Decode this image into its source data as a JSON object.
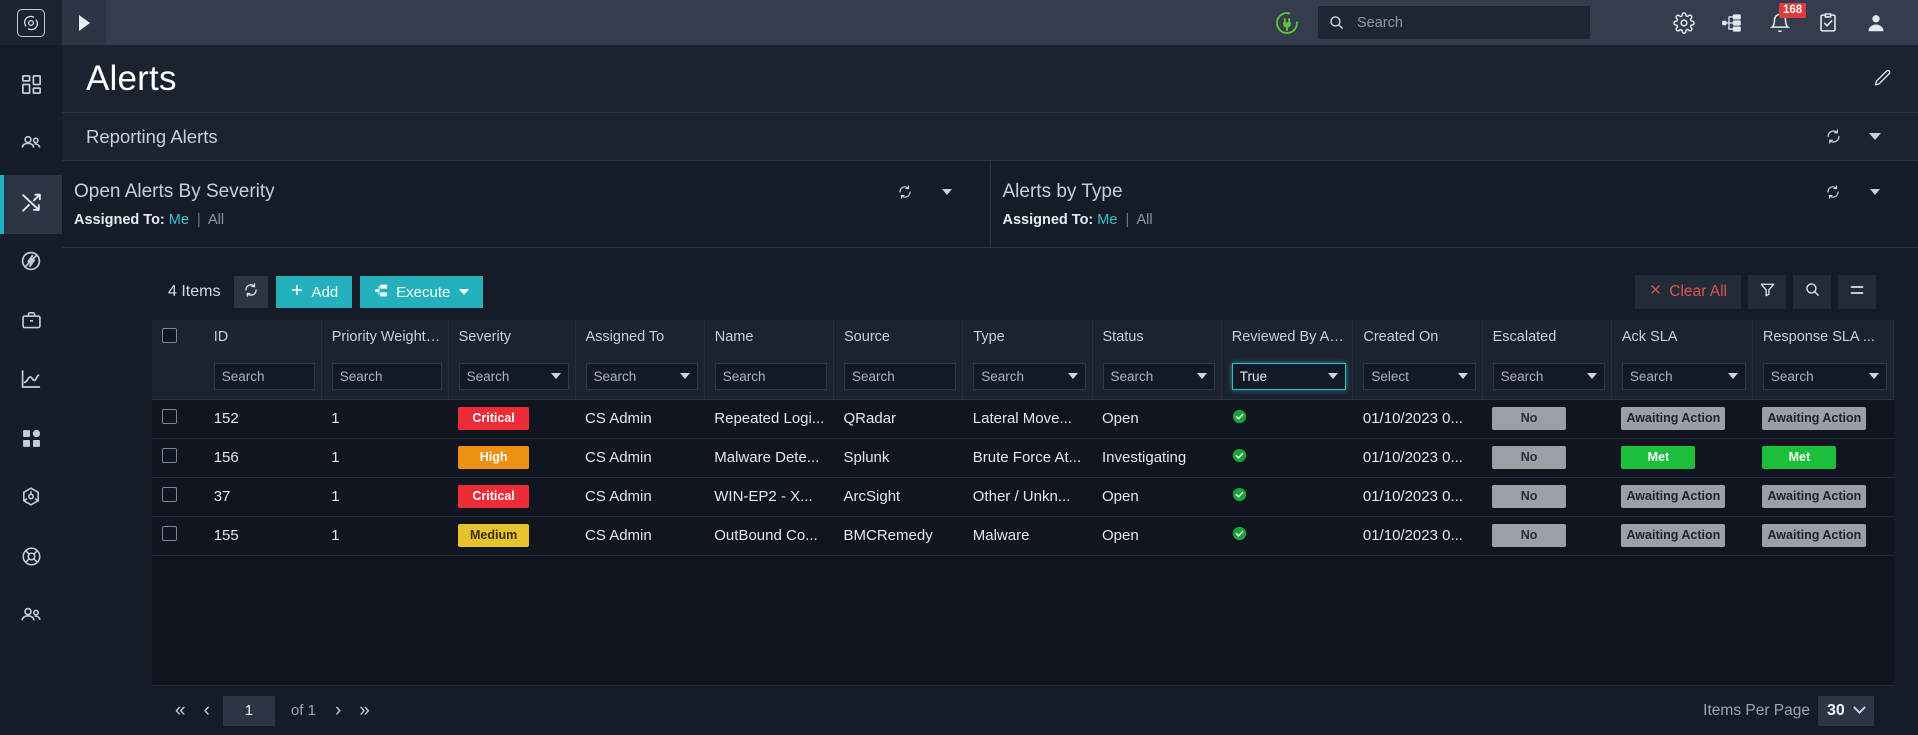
{
  "topbar": {
    "logo_icon": "orbit-logo-icon",
    "collapse_icon": "expand-panel-icon",
    "plug_icon": "plugin-status-icon",
    "search": {
      "value": "",
      "placeholder": "Search",
      "icon": "search-icon"
    },
    "icons": [
      {
        "name": "gear-icon",
        "label": "Settings"
      },
      {
        "name": "sitemap-icon",
        "label": "Hierarchy"
      },
      {
        "name": "bell-icon",
        "label": "Notifications",
        "badge": "168"
      },
      {
        "name": "clipboard-check-icon",
        "label": "Tasks"
      },
      {
        "name": "user-icon",
        "label": "Profile"
      }
    ]
  },
  "sidebar": {
    "items": [
      {
        "name": "sidebar-item-dashboard",
        "icon": "dashboard-grid-icon",
        "active": false
      },
      {
        "name": "sidebar-item-people",
        "icon": "people-icon",
        "active": false
      },
      {
        "name": "sidebar-item-alerts",
        "icon": "shuffle-arrows-icon",
        "active": true
      },
      {
        "name": "sidebar-item-automation",
        "icon": "lightning-circle-icon",
        "active": false
      },
      {
        "name": "sidebar-item-cases",
        "icon": "briefcase-icon",
        "active": false
      },
      {
        "name": "sidebar-item-reports",
        "icon": "line-chart-icon",
        "active": false
      },
      {
        "name": "sidebar-item-widgets",
        "icon": "widgets-grid-icon",
        "active": false
      },
      {
        "name": "sidebar-item-threat",
        "icon": "hexagon-target-icon",
        "active": false
      },
      {
        "name": "sidebar-item-support",
        "icon": "life-ring-icon",
        "active": false
      },
      {
        "name": "sidebar-item-users",
        "icon": "users-icon",
        "active": false
      }
    ]
  },
  "page": {
    "title": "Alerts",
    "edit_icon": "pencil-icon",
    "section_title": "Reporting Alerts",
    "refresh_icon": "refresh-icon",
    "caret_icon": "chevron-down-icon"
  },
  "widgets": [
    {
      "title": "Open Alerts By Severity",
      "assigned_label": "Assigned To:",
      "assigned_me": "Me",
      "assigned_sep": "|",
      "assigned_all": "All"
    },
    {
      "title": "Alerts by Type",
      "assigned_label": "Assigned To:",
      "assigned_me": "Me",
      "assigned_sep": "|",
      "assigned_all": "All"
    }
  ],
  "toolbar": {
    "items_count": "4 Items",
    "refresh_icon": "refresh-icon",
    "add_label": "Add",
    "add_icon": "plus-icon",
    "execute_label": "Execute",
    "execute_icon": "execute-icon",
    "execute_caret": "chevron-down-icon",
    "clear_all_label": "Clear All",
    "clear_all_icon": "close-x-icon",
    "filter_icon": "funnel-icon",
    "search_icon": "search-icon",
    "menu_icon": "hamburger-menu-icon"
  },
  "table": {
    "columns": [
      {
        "key": "checkbox",
        "label": ""
      },
      {
        "key": "id",
        "label": "ID",
        "filter": {
          "type": "text",
          "value": "Search"
        }
      },
      {
        "key": "priority",
        "label": "Priority Weight ...",
        "filter": {
          "type": "text",
          "value": "Search"
        }
      },
      {
        "key": "severity",
        "label": "Severity",
        "filter": {
          "type": "select",
          "value": "Search"
        }
      },
      {
        "key": "assigned",
        "label": "Assigned To",
        "filter": {
          "type": "select",
          "value": "Search"
        }
      },
      {
        "key": "name",
        "label": "Name",
        "filter": {
          "type": "text",
          "value": "Search"
        }
      },
      {
        "key": "source",
        "label": "Source",
        "filter": {
          "type": "text",
          "value": "Search"
        }
      },
      {
        "key": "type",
        "label": "Type",
        "filter": {
          "type": "select",
          "value": "Search"
        }
      },
      {
        "key": "status",
        "label": "Status",
        "filter": {
          "type": "select",
          "value": "Search"
        }
      },
      {
        "key": "reviewed",
        "label": "Reviewed By Analy",
        "filter": {
          "type": "select",
          "value": "True",
          "focused": true
        }
      },
      {
        "key": "created",
        "label": "Created On",
        "filter": {
          "type": "select",
          "value": "Select"
        }
      },
      {
        "key": "escalated",
        "label": "Escalated",
        "filter": {
          "type": "select",
          "value": "Search"
        }
      },
      {
        "key": "ack_sla",
        "label": "Ack SLA",
        "filter": {
          "type": "select",
          "value": "Search"
        }
      },
      {
        "key": "resp_sla",
        "label": "Response SLA ...",
        "filter": {
          "type": "select",
          "value": "Search"
        }
      }
    ],
    "rows": [
      {
        "id": "152",
        "priority": "1",
        "severity": "Critical",
        "severity_class": "sev-critical",
        "assigned": "CS Admin",
        "name": "Repeated Logi...",
        "source": "QRadar",
        "type": "Lateral Move...",
        "status": "Open",
        "reviewed_icon": "green-check-icon",
        "created": "01/10/2023 0...",
        "escalated": "No",
        "escalated_class": "gray",
        "ack_sla": "Awaiting Action",
        "ack_sla_class": "sla-gray",
        "resp_sla": "Awaiting Action",
        "resp_sla_class": "sla-gray"
      },
      {
        "id": "156",
        "priority": "1",
        "severity": "High",
        "severity_class": "sev-high",
        "assigned": "CS Admin",
        "name": "Malware Dete...",
        "source": "Splunk",
        "type": "Brute Force At...",
        "status": "Investigating",
        "reviewed_icon": "green-check-icon",
        "created": "01/10/2023 0...",
        "escalated": "No",
        "escalated_class": "gray",
        "ack_sla": "Met",
        "ack_sla_class": "green",
        "resp_sla": "Met",
        "resp_sla_class": "green"
      },
      {
        "id": "37",
        "priority": "1",
        "severity": "Critical",
        "severity_class": "sev-critical",
        "assigned": "CS Admin",
        "name": "WIN-EP2 - X...",
        "source": "ArcSight",
        "type": "Other / Unkn...",
        "status": "Open",
        "reviewed_icon": "green-check-icon",
        "created": "01/10/2023 0...",
        "escalated": "No",
        "escalated_class": "gray",
        "ack_sla": "Awaiting Action",
        "ack_sla_class": "sla-gray",
        "resp_sla": "Awaiting Action",
        "resp_sla_class": "sla-gray"
      },
      {
        "id": "155",
        "priority": "1",
        "severity": "Medium",
        "severity_class": "sev-medium",
        "assigned": "CS Admin",
        "name": "OutBound Co...",
        "source": "BMCRemedy",
        "type": "Malware",
        "status": "Open",
        "reviewed_icon": "green-check-icon",
        "created": "01/10/2023 0...",
        "escalated": "No",
        "escalated_class": "gray",
        "ack_sla": "Awaiting Action",
        "ack_sla_class": "sla-gray",
        "resp_sla": "Awaiting Action",
        "resp_sla_class": "sla-gray"
      }
    ]
  },
  "pagination": {
    "first": "«",
    "prev": "‹",
    "page": "1",
    "of": "of 1",
    "next": "›",
    "last": "»",
    "items_per_page_label": "Items Per Page",
    "items_per_page_value": "30"
  },
  "colors": {
    "accent_teal": "#24b1bd",
    "link_teal": "#36c2cf",
    "critical": "#ee2b37",
    "high": "#ee9014",
    "medium": "#e6c22e",
    "met_green": "#1bbf3a",
    "danger_red": "#e0514e",
    "badge_red": "#e03b3b"
  }
}
